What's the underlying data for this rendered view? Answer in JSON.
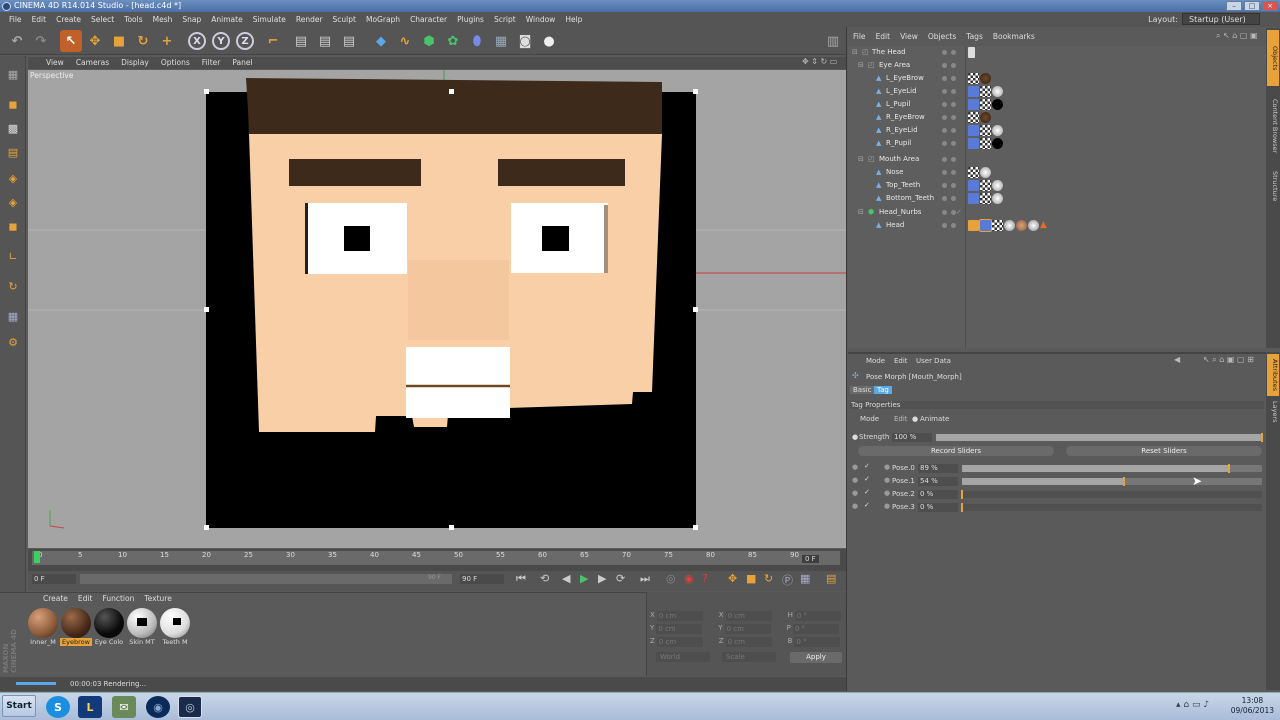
{
  "window": {
    "title": "CINEMA 4D R14.014 Studio - [head.c4d *]"
  },
  "menubar": [
    "File",
    "Edit",
    "Create",
    "Select",
    "Tools",
    "Mesh",
    "Snap",
    "Animate",
    "Simulate",
    "Render",
    "Sculpt",
    "MoGraph",
    "Character",
    "Plugins",
    "Script",
    "Window",
    "Help"
  ],
  "layout": {
    "label": "Layout:",
    "value": "Startup (User)"
  },
  "viewport": {
    "menu": [
      "View",
      "Cameras",
      "Display",
      "Options",
      "Filter",
      "Panel"
    ],
    "label": "Perspective"
  },
  "timeline": {
    "ticks": [
      "0",
      "5",
      "10",
      "15",
      "20",
      "25",
      "30",
      "35",
      "40",
      "45",
      "50",
      "55",
      "60",
      "65",
      "70",
      "75",
      "80",
      "85",
      "90"
    ],
    "end_label": "0 F",
    "start_field": "0 F",
    "end_field": "90 F",
    "mid_field": "90 F"
  },
  "material_manager": {
    "menu": [
      "Create",
      "Edit",
      "Function",
      "Texture"
    ],
    "materials": [
      {
        "label": "Inner_M",
        "color": "#8a5a3a"
      },
      {
        "label": "Eyebrow",
        "color": "#4a2a1a"
      },
      {
        "label": "Eye Colo",
        "color": "#0a0a0a"
      },
      {
        "label": "Skin MT",
        "color": "#e0e0e0"
      },
      {
        "label": "Teeth M",
        "color": "#f5f5f5"
      }
    ],
    "brand": "MAXON CINEMA 4D"
  },
  "coordinates": {
    "rows": [
      {
        "a": "X",
        "av": "0 cm",
        "b": "X",
        "bv": "0 cm",
        "c": "H",
        "cv": "0 °"
      },
      {
        "a": "Y",
        "av": "0 cm",
        "b": "Y",
        "bv": "0 cm",
        "c": "P",
        "cv": "0 °"
      },
      {
        "a": "Z",
        "av": "0 cm",
        "b": "Z",
        "bv": "0 cm",
        "c": "B",
        "cv": "0 °"
      }
    ],
    "world": "World",
    "scale": "Scale",
    "apply": "Apply"
  },
  "status": {
    "text": "00:00:03 Rendering..."
  },
  "objects": {
    "menu": [
      "File",
      "Edit",
      "View",
      "Objects",
      "Tags",
      "Bookmarks"
    ],
    "items": [
      {
        "name": "The Head",
        "indent": 0
      },
      {
        "name": "Eye Area",
        "indent": 1
      },
      {
        "name": "L_EyeBrow",
        "indent": 2
      },
      {
        "name": "L_EyeLid",
        "indent": 2
      },
      {
        "name": "L_Pupil",
        "indent": 2
      },
      {
        "name": "R_EyeBrow",
        "indent": 2
      },
      {
        "name": "R_EyeLid",
        "indent": 2
      },
      {
        "name": "R_Pupil",
        "indent": 2
      },
      {
        "name": "Mouth Area",
        "indent": 1
      },
      {
        "name": "Nose",
        "indent": 2
      },
      {
        "name": "Top_Teeth",
        "indent": 2
      },
      {
        "name": "Bottom_Teeth",
        "indent": 2
      },
      {
        "name": "Head_Nurbs",
        "indent": 1
      },
      {
        "name": "Head",
        "indent": 2
      }
    ],
    "side_tabs": [
      "Objects",
      "Content Browser",
      "Structure"
    ]
  },
  "attributes": {
    "menu": [
      "Mode",
      "Edit",
      "User Data"
    ],
    "title": "Pose Morph [Mouth_Morph]",
    "tabs": [
      "Basic",
      "Tag"
    ],
    "section": "Tag Properties",
    "mode_label": "Mode",
    "mode_edit": "Edit",
    "mode_animate": "Animate",
    "strength_label": "Strength",
    "strength_value": "100 %",
    "strength": 1.0,
    "record_button": "Record Sliders",
    "reset_button": "Reset Sliders",
    "poses": [
      {
        "name": "Pose.0",
        "value": "89 %",
        "fraction": 0.89
      },
      {
        "name": "Pose.1",
        "value": "54 %",
        "fraction": 0.54
      },
      {
        "name": "Pose.2",
        "value": "0 %",
        "fraction": 0
      },
      {
        "name": "Pose.3",
        "value": "0 %",
        "fraction": 0
      }
    ],
    "side_tabs": [
      "Attributes",
      "Layers"
    ]
  },
  "taskbar": {
    "start": "Start",
    "time": "13:08",
    "date": "09/06/2013"
  }
}
